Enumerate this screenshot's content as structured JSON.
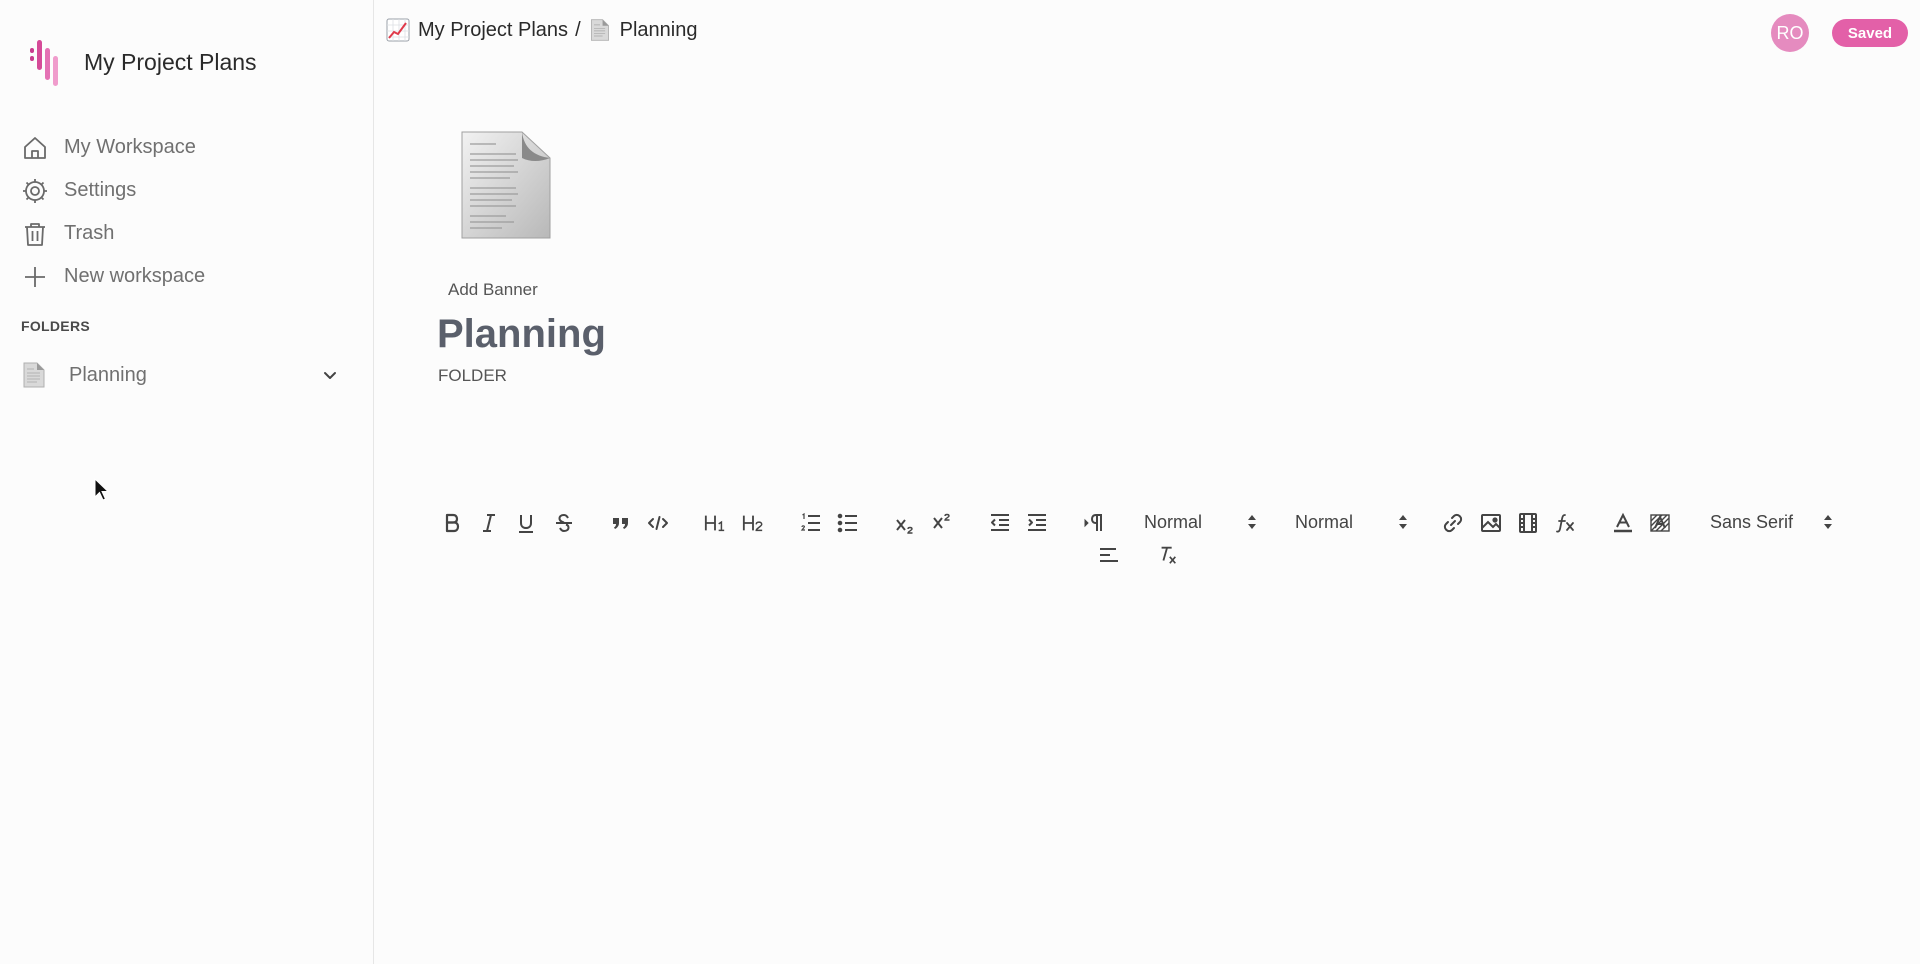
{
  "app": {
    "title": "My Project Plans"
  },
  "sidebar": {
    "items": [
      {
        "label": "My Workspace",
        "icon": "home-icon"
      },
      {
        "label": "Settings",
        "icon": "gear-icon"
      },
      {
        "label": "Trash",
        "icon": "trash-icon"
      },
      {
        "label": "New workspace",
        "icon": "plus-icon"
      }
    ],
    "folders_heading": "FOLDERS",
    "folders": [
      {
        "label": "Planning",
        "icon": "document-icon"
      }
    ]
  },
  "header": {
    "breadcrumb": [
      {
        "label": "My Project Plans",
        "icon": "chart-increasing-icon"
      },
      {
        "label": "Planning",
        "icon": "document-icon"
      }
    ],
    "separator": "/",
    "avatar_initials": "RO",
    "status": "Saved"
  },
  "main": {
    "add_banner": "Add Banner",
    "title": "Planning",
    "subtitle": "FOLDER"
  },
  "toolbar": {
    "header1": "H1",
    "header2": "H2",
    "size_select": "Normal",
    "header_select": "Normal",
    "font_select": "Sans Serif"
  },
  "colors": {
    "accent": "#e360a8",
    "avatar": "#e58bbf",
    "title": "#5a5f6b"
  }
}
